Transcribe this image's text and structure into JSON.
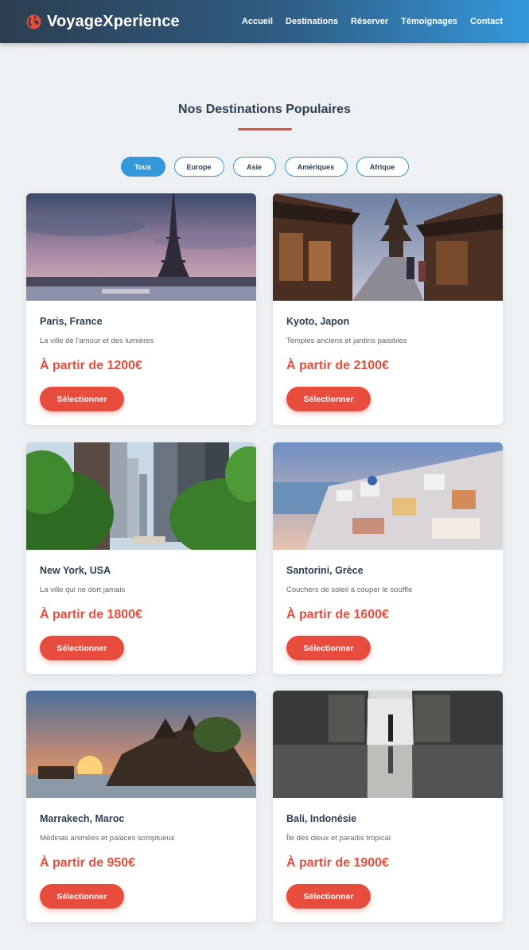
{
  "header": {
    "logo_text": "VoyageXperience",
    "nav": [
      "Accueil",
      "Destinations",
      "Réserver",
      "Témoignages",
      "Contact"
    ]
  },
  "section": {
    "title": "Nos Destinations Populaires"
  },
  "filters": {
    "items": [
      "Tous",
      "Europe",
      "Asie",
      "Amériques",
      "Afrique"
    ],
    "active": "Tous"
  },
  "cards": [
    {
      "title": "Paris, France",
      "desc": "La ville de l'amour et des lumières",
      "price": "À partir de 1200€",
      "button": "Sélectionner"
    },
    {
      "title": "Kyoto, Japon",
      "desc": "Temples anciens et jardins paisibles",
      "price": "À partir de 2100€",
      "button": "Sélectionner"
    },
    {
      "title": "New York, USA",
      "desc": "La ville qui ne dort jamais",
      "price": "À partir de 1800€",
      "button": "Sélectionner"
    },
    {
      "title": "Santorini, Grèce",
      "desc": "Couchers de soleil à couper le souffle",
      "price": "À partir de 1600€",
      "button": "Sélectionner"
    },
    {
      "title": "Marrakech, Maroc",
      "desc": "Médinas animées et palaces somptueux",
      "price": "À partir de 950€",
      "button": "Sélectionner"
    },
    {
      "title": "Bali, Indonésie",
      "desc": "Île des dieux et paradis tropical",
      "price": "À partir de 1900€",
      "button": "Sélectionner"
    }
  ],
  "colors": {
    "accent": "#e74c3c",
    "primary": "#3498db",
    "dark": "#2c3e50",
    "background": "#eef1f3"
  }
}
